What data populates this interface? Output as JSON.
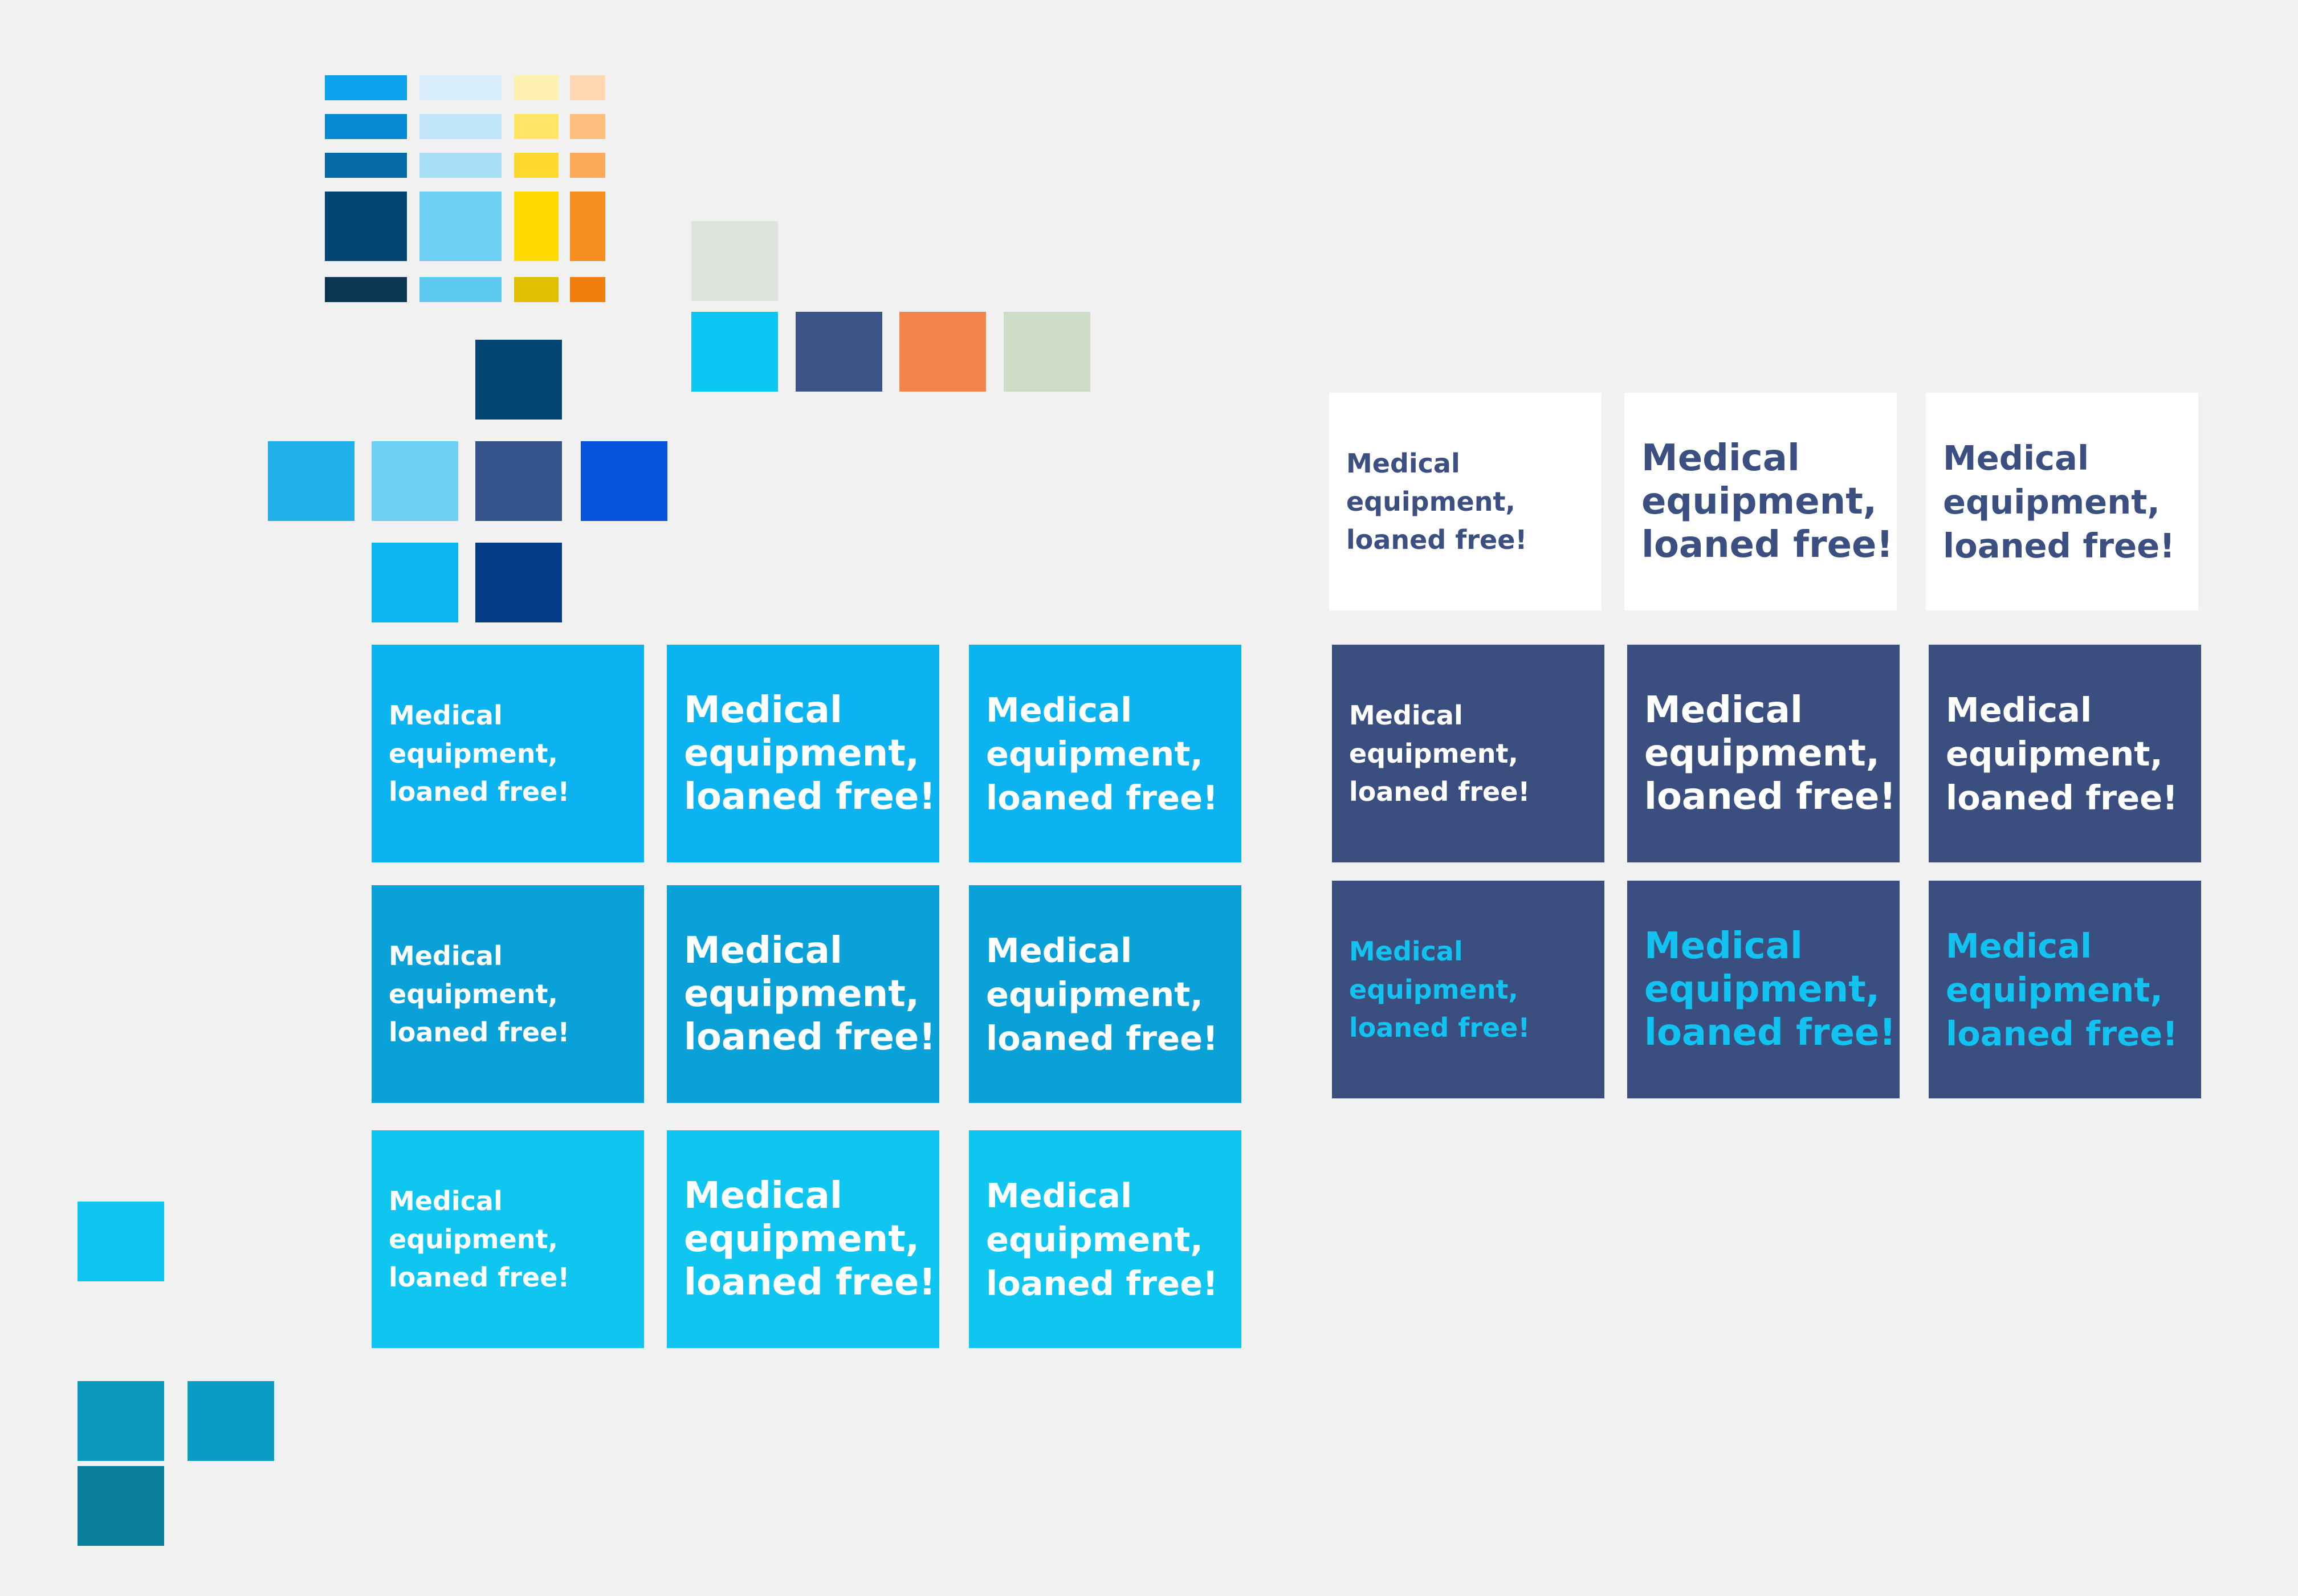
{
  "palette": {
    "blue_ramp": [
      "#0aa1ed",
      "#0788d0",
      "#066aa8",
      "#034673",
      "#0a3652"
    ],
    "light_blue_ramp": [
      "#d8edfb",
      "#c2e6f9",
      "#a6def6",
      "#6ccff3",
      "#5cc8f0"
    ],
    "yellow_ramp": [
      "#fcefb0",
      "#ffe563",
      "#ffd82e",
      "#ffd900",
      "#dfc000"
    ],
    "orange_ramp": [
      "#ffd8b3",
      "#fdbf7d",
      "#fdab5a",
      "#f78f20",
      "#f07e0f"
    ],
    "accents": [
      "#dce4dc",
      "#0bc5f2",
      "#3d5488",
      "#f5844c",
      "#cddcc6"
    ],
    "cross": [
      "#034673",
      "#1fb0ea",
      "#6ccff3",
      "#34538a",
      "#0753dd",
      "#0bb5f2",
      "#033c85"
    ],
    "bottom_left": [
      "#0fc5f2",
      "#0a97bd",
      "#0a9dc4",
      "#087e9b"
    ]
  },
  "cards": {
    "line1": "Medical",
    "line2": "equipment,",
    "line3": "loaned free!",
    "colors": {
      "cyan": "#0bb4f1",
      "deep_cyan": "#09a1d8",
      "light_cyan": "#0fc6f1",
      "white": "#ffffff",
      "navy": "#3a4e7f",
      "cyan_text": "#12c3f1",
      "navy_text": "#3b4f80"
    }
  }
}
